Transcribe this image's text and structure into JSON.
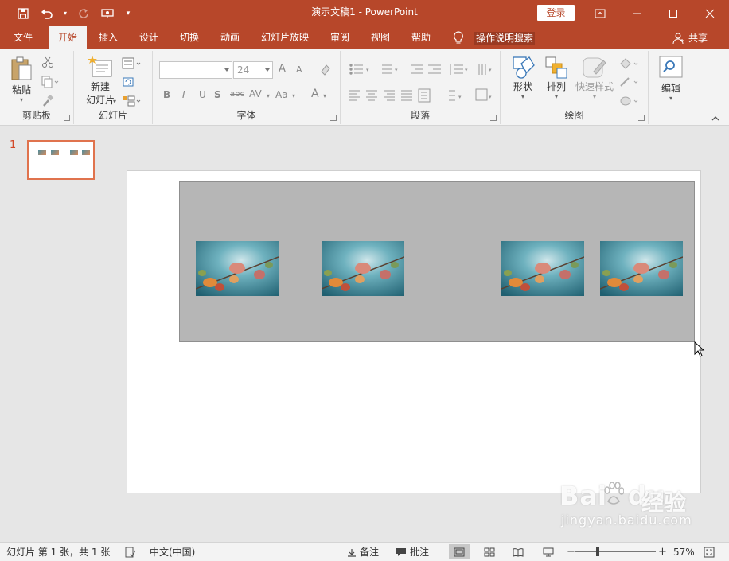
{
  "window": {
    "title": "演示文稿1  -  PowerPoint",
    "login_label": "登录"
  },
  "tabs": [
    {
      "label": "文件"
    },
    {
      "label": "开始",
      "active": true
    },
    {
      "label": "插入"
    },
    {
      "label": "设计"
    },
    {
      "label": "切换"
    },
    {
      "label": "动画"
    },
    {
      "label": "幻灯片放映"
    },
    {
      "label": "审阅"
    },
    {
      "label": "视图"
    },
    {
      "label": "帮助"
    }
  ],
  "tell_me": "操作说明搜索",
  "share_label": "共享",
  "ribbon": {
    "clipboard": {
      "label": "剪贴板",
      "paste": "粘贴"
    },
    "slides": {
      "label": "幻灯片",
      "new_slide_line1": "新建",
      "new_slide_line2": "幻灯片"
    },
    "font": {
      "label": "字体",
      "size_value": "24",
      "increase": "A",
      "decrease": "A",
      "bold": "B",
      "italic": "I",
      "underline": "U",
      "strike": "abc",
      "spacing": "AV",
      "case": "Aa",
      "color": "A"
    },
    "paragraph": {
      "label": "段落"
    },
    "drawing": {
      "label": "绘图",
      "shapes": "形状",
      "arrange": "排列",
      "quick_styles": "快速样式"
    },
    "editing": {
      "label": "编辑"
    }
  },
  "thumbnails": [
    {
      "number": "1"
    }
  ],
  "statusbar": {
    "slide_info": "幻灯片 第 1 张，共 1 张",
    "language": "中文(中国)",
    "notes": "备注",
    "comments": "批注",
    "zoom": "57%"
  },
  "watermark": {
    "brand": "Bai",
    "brand_tail": "du",
    "cn": "经验",
    "sub": "jingyan.baidu.com"
  },
  "colors": {
    "accent": "#b7472a",
    "ribbon_bg": "#f3f3f3",
    "selection": "#e0734d"
  }
}
